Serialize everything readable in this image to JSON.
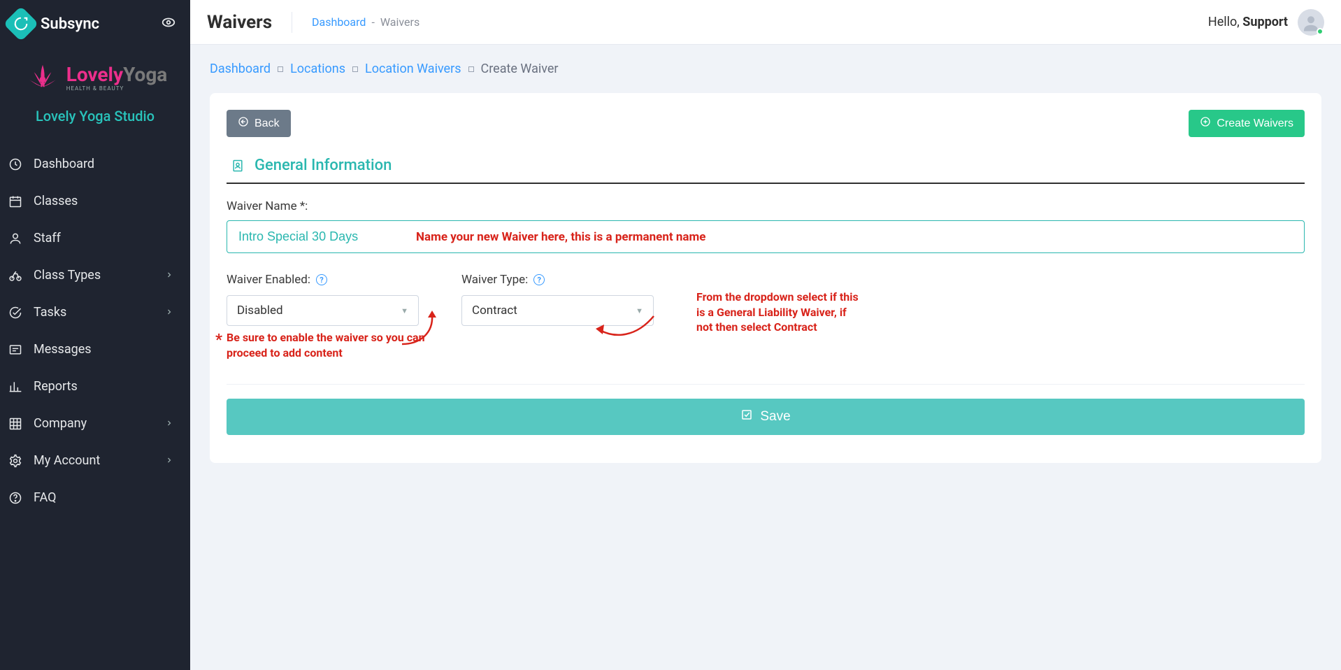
{
  "brand": {
    "name": "Subsync"
  },
  "studio": {
    "logo_line1a": "Lovely",
    "logo_line1b": "Yoga",
    "logo_tag": "HEALTH & BEAUTY",
    "label": "Lovely Yoga Studio"
  },
  "sidebar": {
    "items": [
      {
        "id": "dashboard",
        "label": "Dashboard",
        "expandable": false
      },
      {
        "id": "classes",
        "label": "Classes",
        "expandable": false
      },
      {
        "id": "staff",
        "label": "Staff",
        "expandable": false
      },
      {
        "id": "class-types",
        "label": "Class Types",
        "expandable": true
      },
      {
        "id": "tasks",
        "label": "Tasks",
        "expandable": true
      },
      {
        "id": "messages",
        "label": "Messages",
        "expandable": false
      },
      {
        "id": "reports",
        "label": "Reports",
        "expandable": false
      },
      {
        "id": "company",
        "label": "Company",
        "expandable": true
      },
      {
        "id": "my-account",
        "label": "My Account",
        "expandable": true
      },
      {
        "id": "faq",
        "label": "FAQ",
        "expandable": false
      }
    ]
  },
  "header": {
    "title": "Waivers",
    "crumbs": {
      "dashboard": "Dashboard",
      "sep": "-",
      "current": "Waivers"
    },
    "greeting_prefix": "Hello,",
    "greeting_user": "Support"
  },
  "breadcrumbs": {
    "items": [
      {
        "label": "Dashboard",
        "link": true
      },
      {
        "label": "Locations",
        "link": true
      },
      {
        "label": "Location Waivers",
        "link": true
      },
      {
        "label": "Create Waiver",
        "link": false
      }
    ]
  },
  "card": {
    "back": "Back",
    "create": "Create Waivers",
    "section_title": "General Information",
    "waiver_name_label": "Waiver Name *:",
    "waiver_name_value": "Intro Special 30 Days",
    "waiver_name_note": "Name your new Waiver here, this is a permanent name",
    "enabled_label": "Waiver Enabled:",
    "enabled_value": "Disabled",
    "type_label": "Waiver Type:",
    "type_value": "Contract",
    "save": "Save"
  },
  "annotations": {
    "star": "*",
    "enabled_note": "Be sure to enable the waiver so you can proceed to add content",
    "type_note": "From the dropdown select if this is a General Liability Waiver, if not then select Contract"
  }
}
